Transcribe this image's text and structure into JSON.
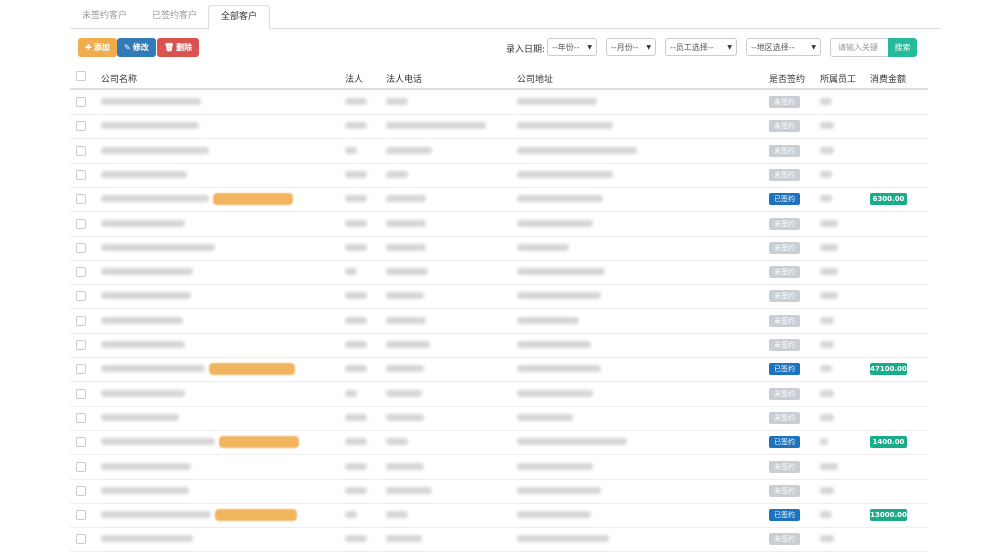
{
  "tabs": [
    {
      "label": "未签约客户",
      "active": false
    },
    {
      "label": "已签约客户",
      "active": false
    },
    {
      "label": "全部客户",
      "active": true
    }
  ],
  "toolbar": {
    "add_label": "添加",
    "edit_label": "修改",
    "delete_label": "删除"
  },
  "filters": {
    "date_label": "录入日期:",
    "year": "--年份--",
    "month": "--月份--",
    "staff": "--员工选择--",
    "region": "--地区选择--",
    "search_placeholder": "请输入关键",
    "search_label": "搜索"
  },
  "table": {
    "headers": {
      "company": "公司名称",
      "legal": "法人",
      "phone": "法人电话",
      "address": "公司地址",
      "signed": "是否签约",
      "staff": "所属员工",
      "amount": "消费金额"
    },
    "rows": [
      {
        "signed": "未签约",
        "is_signed": false,
        "amount": ""
      },
      {
        "signed": "未签约",
        "is_signed": false,
        "amount": ""
      },
      {
        "signed": "未签约",
        "is_signed": false,
        "amount": ""
      },
      {
        "signed": "未签约",
        "is_signed": false,
        "amount": ""
      },
      {
        "signed": "已签约",
        "is_signed": true,
        "amount": "6300.00"
      },
      {
        "signed": "未签约",
        "is_signed": false,
        "amount": ""
      },
      {
        "signed": "未签约",
        "is_signed": false,
        "amount": ""
      },
      {
        "signed": "未签约",
        "is_signed": false,
        "amount": ""
      },
      {
        "signed": "未签约",
        "is_signed": false,
        "amount": ""
      },
      {
        "signed": "未签约",
        "is_signed": false,
        "amount": ""
      },
      {
        "signed": "未签约",
        "is_signed": false,
        "amount": ""
      },
      {
        "signed": "已签约",
        "is_signed": true,
        "amount": "47100.00"
      },
      {
        "signed": "未签约",
        "is_signed": false,
        "amount": ""
      },
      {
        "signed": "未签约",
        "is_signed": false,
        "amount": ""
      },
      {
        "signed": "已签约",
        "is_signed": true,
        "amount": "1400.00"
      },
      {
        "signed": "未签约",
        "is_signed": false,
        "amount": ""
      },
      {
        "signed": "未签约",
        "is_signed": false,
        "amount": ""
      },
      {
        "signed": "已签约",
        "is_signed": true,
        "amount": "13000.00"
      },
      {
        "signed": "未签约",
        "is_signed": false,
        "amount": ""
      }
    ]
  },
  "colors": {
    "add": "#f0ad4e",
    "edit": "#337ab7",
    "delete": "#d9534f",
    "search": "#26b99a",
    "signed": "#1e73be",
    "unsigned": "#c8ced4",
    "amount": "#1aab8a"
  },
  "icons": {
    "add": "plus-icon",
    "edit": "edit-icon",
    "delete": "trash-icon"
  }
}
